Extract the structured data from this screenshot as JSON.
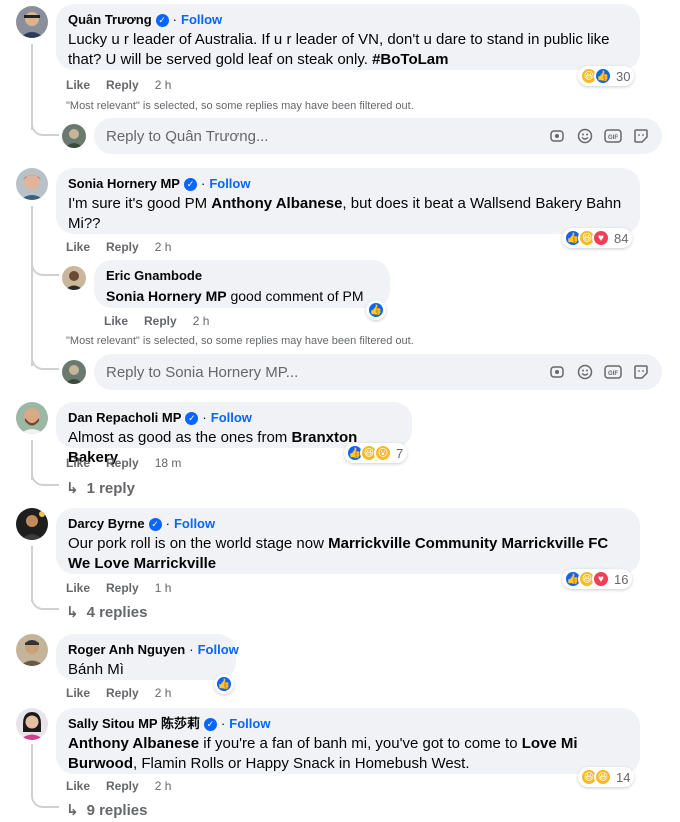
{
  "common": {
    "like": "Like",
    "reply": "Reply",
    "follow": "Follow",
    "filter_notice": "\"Most relevant\" is selected, so some replies may have been filtered out."
  },
  "comments": [
    {
      "author": "Quân Trương",
      "text": "Lucky u r leader of Australia. If u r leader of VN, don't u dare to stand in public like that? U will be served gold leaf on steak only.",
      "hashtag": "#BoToLam",
      "time": "2 h",
      "reactions": [
        "haha",
        "like"
      ],
      "reaction_count": "30",
      "reply_placeholder": "Reply to Quân Trương..."
    },
    {
      "author": "Sonia Hornery MP",
      "text_a": "I'm sure it's good PM ",
      "mention": "Anthony Albanese",
      "text_b": ", but does it beat a Wallsend Bakery Bahn Mi??",
      "time": "2 h",
      "reactions": [
        "like",
        "haha",
        "love"
      ],
      "reaction_count": "84",
      "reply": {
        "author": "Eric Gnambode",
        "mention": "Sonia Hornery MP",
        "text": " good comment of PM",
        "time": "2 h",
        "reactions": [
          "like"
        ]
      },
      "reply_placeholder": "Reply to Sonia Hornery MP..."
    },
    {
      "author": "Dan Repacholi MP",
      "text": "Almost as good as the ones from ",
      "mention": "Branxton Bakery",
      "time": "18 m",
      "reactions": [
        "like",
        "haha",
        "wow"
      ],
      "reaction_count": "7",
      "replies_link": "1 reply"
    },
    {
      "author": "Darcy Byrne",
      "text": "Our pork roll is on the world stage now ",
      "mention": "Marrickville Community Marrickville FC We Love Marrickville",
      "time": "1 h",
      "reactions": [
        "like",
        "haha",
        "love"
      ],
      "reaction_count": "16",
      "replies_link": "4 replies"
    },
    {
      "author": "Roger Anh Nguyen",
      "text": "Bánh Mì",
      "time": "2 h",
      "reactions": [
        "like"
      ]
    },
    {
      "author": "Sally Sitou MP 陈莎莉",
      "mention_a": "Anthony Albanese",
      "text_a": " if you're a fan of banh mi, you've got to come to ",
      "mention_b": "Love Mi Burwood",
      "text_b": ", Flamin Rolls or Happy Snack in Homebush West.",
      "time": "2 h",
      "reactions": [
        "haha",
        "haha"
      ],
      "reaction_count": "14",
      "replies_link": "9 replies"
    }
  ],
  "colors": {
    "bubble": "#f0f2f5",
    "accent": "#0866ff",
    "muted": "#65676b",
    "love": "#f33e58",
    "haha": "#f7b928"
  }
}
